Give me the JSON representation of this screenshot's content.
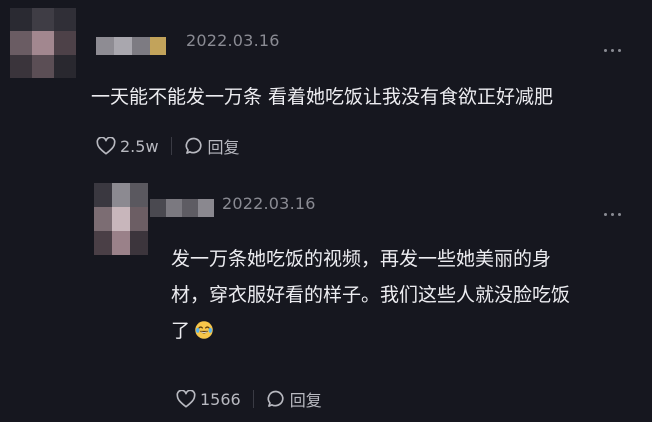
{
  "comments": [
    {
      "date": "2022.03.16",
      "text": "一天能不能发一万条 看着她吃饭让我没有食欲正好减肥",
      "like_count": "2.5w",
      "reply_label": "回复",
      "icons": {
        "like": "heart-icon",
        "reply": "speech-bubble-icon",
        "more": "more-dots-icon"
      }
    },
    {
      "date": "2022.03.16",
      "text_lines": [
        "发一万条她吃饭的视频，再发一些她美丽的身",
        "材，穿衣服好看的样子。我们这些人就没脸吃饭",
        "了"
      ],
      "emoji": "tearful-laugh-emoji",
      "like_count": "1566",
      "reply_label": "回复",
      "icons": {
        "like": "heart-icon",
        "reply": "speech-bubble-icon",
        "more": "more-dots-icon"
      }
    }
  ]
}
